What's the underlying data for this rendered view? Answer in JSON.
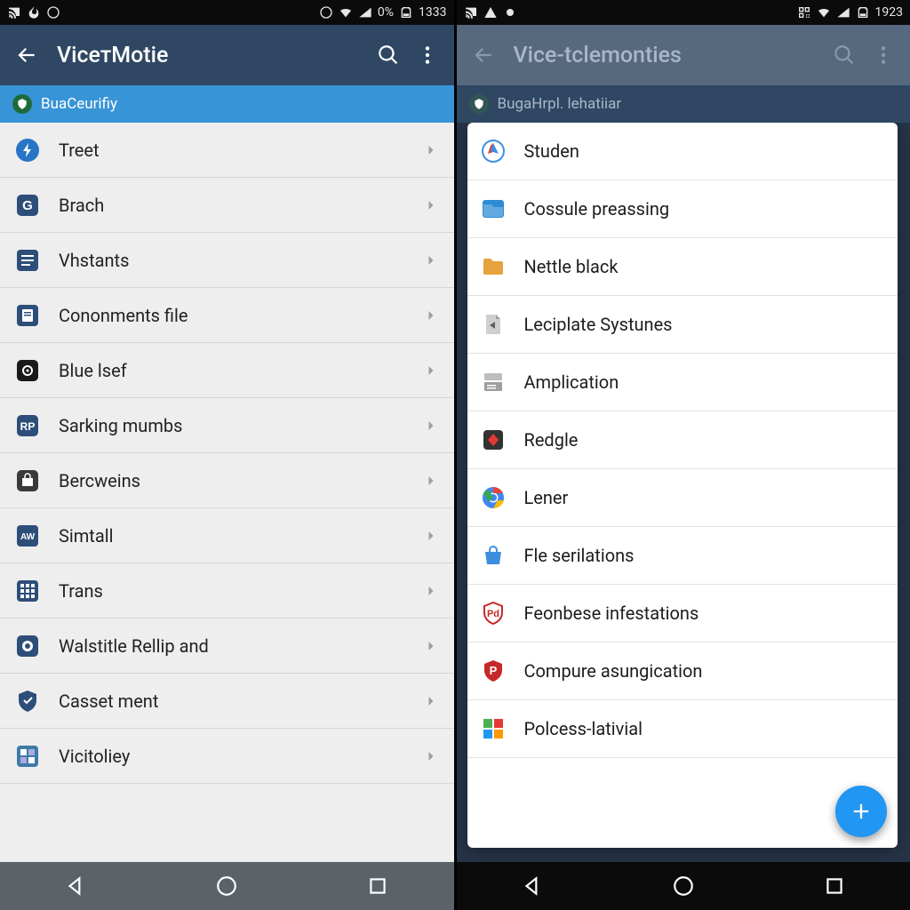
{
  "left": {
    "status": {
      "battery": "0%",
      "time": "1333"
    },
    "appbar": {
      "title": "VicетMotie"
    },
    "section": {
      "label": "BuаCeurifiy"
    },
    "items": [
      {
        "label": "Treet",
        "icon": "bolt-circle",
        "c": "#2874c6"
      },
      {
        "label": "Brach",
        "icon": "square-g",
        "c": "#2e4e7a"
      },
      {
        "label": "Vhstants",
        "icon": "list-square",
        "c": "#2e4e7a"
      },
      {
        "label": "Cononments file",
        "icon": "file-square",
        "c": "#2e4e7a"
      },
      {
        "label": "Blue lsef",
        "icon": "gear-square",
        "c": "#1a1a1a"
      },
      {
        "label": "Sarking mumbs",
        "icon": "rp-square",
        "c": "#2e4e7a"
      },
      {
        "label": "Bercweins",
        "icon": "bag-square",
        "c": "#3a3a3a"
      },
      {
        "label": "Simtall",
        "icon": "aw-square",
        "c": "#2e4e7a"
      },
      {
        "label": "Trans",
        "icon": "grid-square",
        "c": "#2e4e7a"
      },
      {
        "label": "Walstitle Rellip and",
        "icon": "lens-square",
        "c": "#2e4e7a"
      },
      {
        "label": "Casset ment",
        "icon": "shield",
        "c": "#2e4e7a"
      },
      {
        "label": "Vicitoliey",
        "icon": "tiles-square",
        "c": "#3e7aa8"
      }
    ]
  },
  "right": {
    "status": {
      "time": "1923"
    },
    "appbar": {
      "title": "Vice-tclemonties"
    },
    "section": {
      "label": "BugaНrpl. lehatiiar"
    },
    "items": [
      {
        "label": "Studen",
        "icon": "compass",
        "c": "#3c8fde"
      },
      {
        "label": "Cossule preassing",
        "icon": "folder-blue",
        "c": "#2e8cd6"
      },
      {
        "label": "Nettle black",
        "icon": "folder",
        "c": "#e6a23c"
      },
      {
        "label": "Leciplate Systunes",
        "icon": "doc-arrow",
        "c": "#8e8e8e"
      },
      {
        "label": "Amplication",
        "icon": "server",
        "c": "#8e8e8e"
      },
      {
        "label": "Redgle",
        "icon": "diamond-red",
        "c": "#444"
      },
      {
        "label": "Lener",
        "icon": "chrome",
        "c": "#4285f4"
      },
      {
        "label": "Fle serilations",
        "icon": "bag-blue",
        "c": "#3c8fde"
      },
      {
        "label": "Feonbese infestations",
        "icon": "shield-red",
        "c": "#c62828"
      },
      {
        "label": "Compure asungication",
        "icon": "badge-red",
        "c": "#c62828"
      },
      {
        "label": "Polcess-lativial",
        "icon": "blocks",
        "c": "#4caf50"
      }
    ]
  }
}
